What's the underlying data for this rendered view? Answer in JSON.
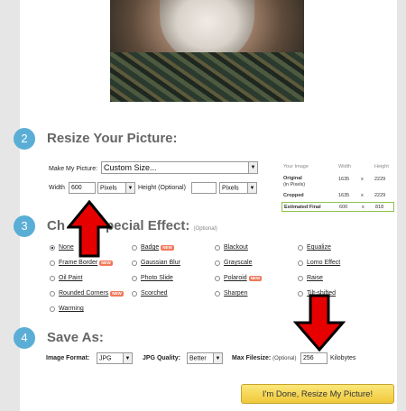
{
  "steps": {
    "resize": {
      "number": "2",
      "title": "Resize Your Picture:"
    },
    "effect": {
      "number": "3",
      "title": "Choose Special Effect:",
      "title_visible": "Ch",
      "title_visible_end": "pecial Effect:",
      "optional": "(Optional)"
    },
    "save": {
      "number": "4",
      "title": "Save As:"
    }
  },
  "resize": {
    "make_label": "Make My Picture:",
    "make_value": "Custom Size...",
    "width_label": "Width",
    "width_value": "600",
    "width_unit": "Pixels",
    "height_label": "Height (Optional)",
    "height_value": "",
    "height_unit": "Pixels"
  },
  "size_info": {
    "header_image": "Your Image",
    "header_width": "Width",
    "header_height": "Height",
    "rows": [
      {
        "label": "Original",
        "sub": "(in Pixels)",
        "width": "1635",
        "x": "x",
        "height": "2229"
      },
      {
        "label": "Cropped",
        "width": "1635",
        "x": "x",
        "height": "2229"
      },
      {
        "label": "Estimated Final",
        "width": "600",
        "x": "x",
        "height": "818"
      }
    ]
  },
  "effects": {
    "new_badge": "NEW",
    "items": [
      {
        "label": "None",
        "selected": true
      },
      {
        "label": "Badge",
        "new": true
      },
      {
        "label": "Blackout"
      },
      {
        "label": "Equalize"
      },
      {
        "label": "Frame Border",
        "new": true
      },
      {
        "label": "Gaussian Blur"
      },
      {
        "label": "Grayscale"
      },
      {
        "label": "Lomo Effect"
      },
      {
        "label": "Oil Paint"
      },
      {
        "label": "Photo Slide"
      },
      {
        "label": "Polaroid",
        "new": true
      },
      {
        "label": "Raise"
      },
      {
        "label": "Rounded Corners",
        "new": true
      },
      {
        "label": "Scorched"
      },
      {
        "label": "Sharpen"
      },
      {
        "label": "Tilt-shifted"
      },
      {
        "label": "Warming"
      }
    ]
  },
  "save": {
    "format_label": "Image Format:",
    "format_value": "JPG",
    "quality_label": "JPG Quality:",
    "quality_value": "Better",
    "filesize_label": "Max Filesize:",
    "filesize_optional": "(Optional)",
    "filesize_value": "256",
    "filesize_unit": "Kilobytes"
  },
  "done_button": "I'm Done, Resize My Picture!",
  "colors": {
    "step_circle": "#5aaed6",
    "arrow": "#e60000",
    "button": "#f0c93a",
    "estimate_border": "#8bc34a"
  }
}
